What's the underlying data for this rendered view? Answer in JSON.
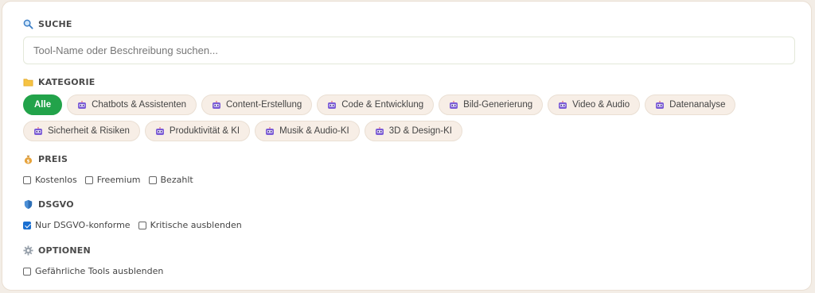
{
  "search": {
    "title": "SUCHE",
    "icon": "magnifier-icon",
    "placeholder": "Tool-Name oder Beschreibung suchen...",
    "value": ""
  },
  "category": {
    "title": "KATEGORIE",
    "icon": "folder-icon",
    "row1": [
      "Alle",
      "Chatbots & Assistenten",
      "Content-Erstellung",
      "Code & Entwicklung",
      "Bild-Generierung",
      "Video & Audio",
      "Datenanalyse"
    ],
    "row2": [
      "Sicherheit & Risiken",
      "Produktivität & KI",
      "Musik & Audio-KI",
      "3D & Design-KI"
    ],
    "selected": "Alle",
    "chip_icon": "robot-icon"
  },
  "price": {
    "title": "PREIS",
    "icon": "money-bag-icon",
    "options": [
      {
        "label": "Kostenlos",
        "checked": false
      },
      {
        "label": "Freemium",
        "checked": false
      },
      {
        "label": "Bezahlt",
        "checked": false
      }
    ]
  },
  "gdpr": {
    "title": "DSGVO",
    "icon": "shield-icon",
    "options": [
      {
        "label": "Nur DSGVO-konforme",
        "checked": true
      },
      {
        "label": "Kritische ausblenden",
        "checked": false
      }
    ]
  },
  "options": {
    "title": "OPTIONEN",
    "icon": "gear-icon",
    "options": [
      {
        "label": "Gefährliche Tools ausblenden",
        "checked": false
      }
    ]
  },
  "colors": {
    "accent": "#22a34a",
    "chip_bg": "#f7eee6",
    "checkbox": "#1a6fd1"
  }
}
